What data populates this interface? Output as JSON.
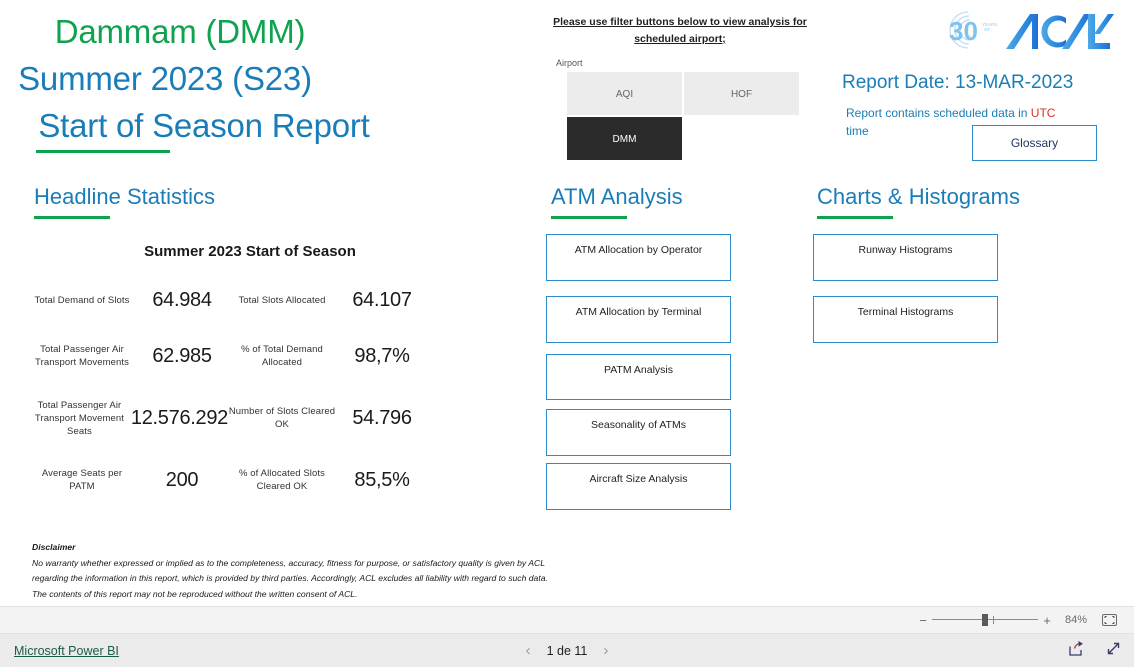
{
  "report": {
    "title_airport": "Dammam (DMM)",
    "title_season": "Summer 2023 (S23)",
    "title_report": "Start of Season Report",
    "report_date": "Report Date: 13-MAR-2023",
    "note_prefix": "Report contains scheduled data in ",
    "note_utc": "UTC",
    "note_suffix": " time",
    "glossary_label": "Glossary",
    "logo_alt": "acl-logo"
  },
  "filter": {
    "instruction": "Please use filter buttons below to view analysis for scheduled airport;",
    "slicer_label": "Airport",
    "tiles": [
      {
        "label": "AQI",
        "selected": false
      },
      {
        "label": "HOF",
        "selected": false
      },
      {
        "label": "DMM",
        "selected": true
      }
    ]
  },
  "headline": {
    "heading": "Headline Statistics",
    "subtitle": "Summer 2023 Start of Season",
    "rows": [
      [
        {
          "label": "Total Demand of Slots",
          "value": "64.984"
        },
        {
          "label": "Total Slots Allocated",
          "value": "64.107"
        }
      ],
      [
        {
          "label": "Total Passenger Air Transport Movements",
          "value": "62.985"
        },
        {
          "label": "% of Total Demand Allocated",
          "value": "98,7%"
        }
      ],
      [
        {
          "label": "Total Passenger Air Transport Movement Seats",
          "value": "12.576.292"
        },
        {
          "label": "Number of Slots Cleared OK",
          "value": "54.796"
        }
      ],
      [
        {
          "label": "Average Seats per PATM",
          "value": "200"
        },
        {
          "label": "% of Allocated Slots Cleared OK",
          "value": "85,5%"
        }
      ]
    ]
  },
  "atm": {
    "heading": "ATM Analysis",
    "buttons": [
      "ATM Allocation by Operator",
      "ATM Allocation by Terminal",
      "PATM Analysis",
      "Seasonality of ATMs",
      "Aircraft Size Analysis"
    ]
  },
  "charts": {
    "heading": "Charts & Histograms",
    "buttons": [
      "Runway Histograms",
      "Terminal Histograms"
    ]
  },
  "disclaimer": {
    "heading": "Disclaimer",
    "line1": "No warranty whether expressed or implied as to the completeness, accuracy, fitness for purpose, or satisfactory quality is given by ACL",
    "line2": "regarding the information in this report, which is provided by third parties. Accordingly, ACL excludes all liability with regard to such data.",
    "line3": "The contents of this report may not be reproduced without the written consent of ACL."
  },
  "statusbar": {
    "zoom_minus": "−",
    "zoom_plus": "+",
    "zoom_percent": "84%",
    "fit_icon": "fit-to-page-icon"
  },
  "footer": {
    "powerbi_label": "Microsoft Power BI",
    "prev_arrow": "‹",
    "page_text": "1 de 11",
    "next_arrow": "›",
    "share_icon": "share-icon",
    "fullscreen_icon": "fullscreen-icon"
  },
  "colors": {
    "green": "#0FA24F",
    "blue": "#1A7DB8",
    "red": "#D93025",
    "selected_tile": "#2B2B2B",
    "unselected_tile": "#ECECEC",
    "button_border": "#2E8BC9"
  }
}
